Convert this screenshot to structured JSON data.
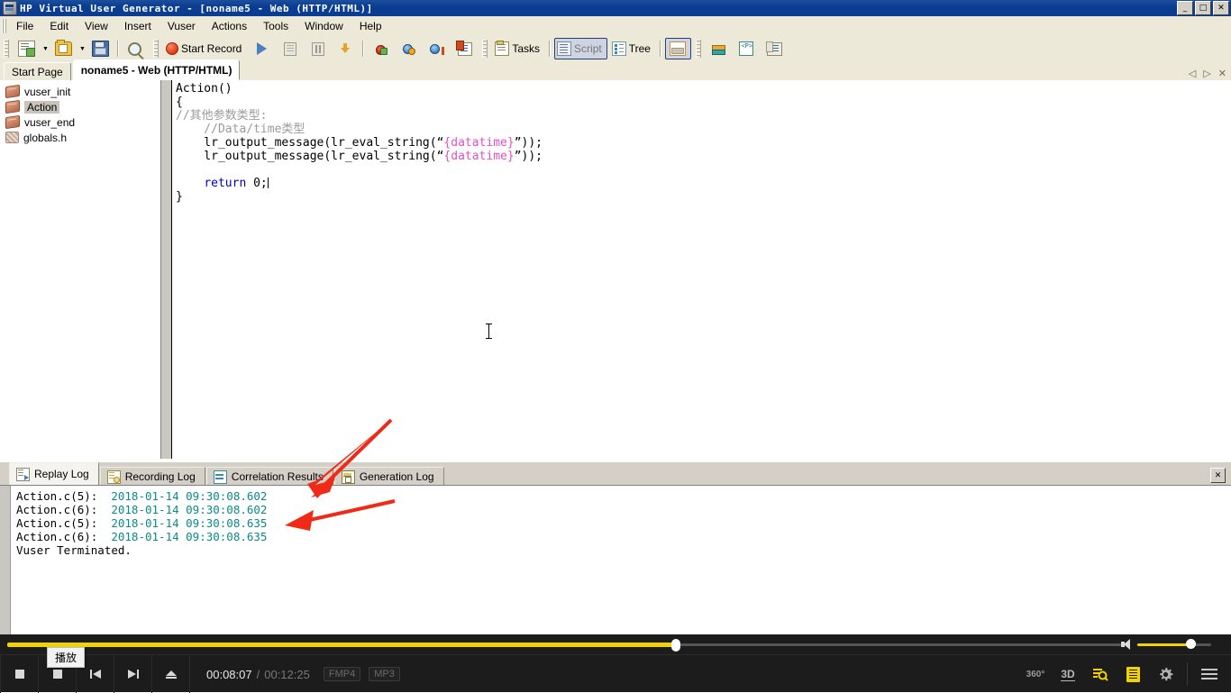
{
  "window": {
    "title": "HP Virtual User Generator - [noname5 - Web (HTTP/HTML)]",
    "app_icon": "vugen-app-icon",
    "minimize": "_",
    "maximize": "□",
    "close": "✕"
  },
  "menubar": {
    "items": [
      {
        "label": "File",
        "mnemonic": "F"
      },
      {
        "label": "Edit",
        "mnemonic": "E"
      },
      {
        "label": "View",
        "mnemonic": "V"
      },
      {
        "label": "Insert",
        "mnemonic": "I"
      },
      {
        "label": "Vuser",
        "mnemonic": "u"
      },
      {
        "label": "Actions",
        "mnemonic": "A"
      },
      {
        "label": "Tools",
        "mnemonic": "T"
      },
      {
        "label": "Window",
        "mnemonic": "W"
      },
      {
        "label": "Help",
        "mnemonic": "H"
      }
    ]
  },
  "toolbar": {
    "new_script_icon": "new-script-icon",
    "open_icon": "open-folder-icon",
    "save_icon": "save-icon",
    "find_icon": "search-icon",
    "start_record_label": "Start Record",
    "record_icon": "record-icon",
    "run_icon": "play-icon",
    "stop_icon": "stop-icon",
    "pause_icon": "pause-icon",
    "download_icon": "download-icon",
    "bug_icon": "bug-icon",
    "clock_icon": "clock-icon",
    "runlogic_icon": "run-logic-icon",
    "props_icon": "properties-icon",
    "tasks_label": "Tasks",
    "tasks_icon": "tasks-icon",
    "script_label": "Script",
    "script_icon": "script-view-icon",
    "tree_label": "Tree",
    "tree_icon": "tree-view-icon",
    "splitview_icon": "split-view-icon",
    "recgen_icon": "recording-options-icon",
    "param_icon": "parameter-list-icon",
    "snapshot_icon": "snapshot-icon",
    "caret": "▼"
  },
  "tabstrip": {
    "tabs": [
      {
        "label": "Start Page",
        "active": false
      },
      {
        "label": "noname5 - Web (HTTP/HTML)",
        "active": true
      }
    ],
    "nav_prev": "◁",
    "nav_next": "▷",
    "nav_close": "✕"
  },
  "tree": {
    "items": [
      {
        "label": "vuser_init",
        "icon": "action-brick-icon",
        "selected": false
      },
      {
        "label": "Action",
        "icon": "action-brick-icon",
        "selected": true
      },
      {
        "label": "vuser_end",
        "icon": "action-brick-icon",
        "selected": false
      },
      {
        "label": "globals.h",
        "icon": "header-file-icon",
        "selected": false
      }
    ]
  },
  "editor": {
    "lines": [
      {
        "segs": [
          {
            "t": "Action()",
            "c": "plain"
          }
        ]
      },
      {
        "segs": [
          {
            "t": "{",
            "c": "plain"
          }
        ]
      },
      {
        "segs": [
          {
            "t": "//其他参数类型:",
            "c": "comment"
          }
        ]
      },
      {
        "segs": [
          {
            "t": "    //Data/time类型",
            "c": "comment"
          }
        ]
      },
      {
        "segs": [
          {
            "t": "    lr_output_message(lr_eval_string(“",
            "c": "plain"
          },
          {
            "t": "{datatime}",
            "c": "param"
          },
          {
            "t": "”));",
            "c": "plain"
          }
        ]
      },
      {
        "segs": [
          {
            "t": "    lr_output_message(lr_eval_string(“",
            "c": "plain"
          },
          {
            "t": "{datatime}",
            "c": "param"
          },
          {
            "t": "”));",
            "c": "plain"
          }
        ]
      },
      {
        "segs": [
          {
            "t": "",
            "c": "plain"
          }
        ]
      },
      {
        "segs": [
          {
            "t": "    ",
            "c": "plain"
          },
          {
            "t": "return",
            "c": "kw"
          },
          {
            "t": " 0;",
            "c": "plain"
          },
          {
            "t": "|",
            "c": "caret"
          }
        ]
      },
      {
        "segs": [
          {
            "t": "}",
            "c": "plain"
          }
        ]
      }
    ]
  },
  "logtabs": {
    "tabs": [
      {
        "label": "Replay Log",
        "icon": "replay-log-icon",
        "active": true
      },
      {
        "label": "Recording Log",
        "icon": "recording-log-icon",
        "active": false
      },
      {
        "label": "Correlation Results",
        "icon": "correlation-results-icon",
        "active": false
      },
      {
        "label": "Generation Log",
        "icon": "generation-log-icon",
        "active": false
      }
    ],
    "close": "✕"
  },
  "log": {
    "lines": [
      {
        "prefix": "Action.c(5):  ",
        "ts": "2018-01-14 09:30:08.602"
      },
      {
        "prefix": "Action.c(6):  ",
        "ts": "2018-01-14 09:30:08.602"
      },
      {
        "prefix": "Action.c(5):  ",
        "ts": "2018-01-14 09:30:08.635"
      },
      {
        "prefix": "Action.c(6):  ",
        "ts": "2018-01-14 09:30:08.635"
      },
      {
        "prefix": "Vuser Terminated.",
        "ts": ""
      }
    ]
  },
  "annotations": {
    "arrow_color": "#ef2b18",
    "arrows": [
      {
        "name": "arrow-to-correlation-tab"
      },
      {
        "name": "arrow-to-log-timestamp"
      }
    ]
  },
  "player": {
    "play_tooltip": "播放",
    "play_icon": "play-icon",
    "prev_icon": "previous-track-icon",
    "next_icon": "next-track-icon",
    "eject_icon": "eject-icon",
    "current_time": "00:08:07",
    "separator": "/",
    "total_time": "00:12:25",
    "format_video": "FMP4",
    "format_audio": "MP3",
    "progress_percent": 60,
    "volume_percent": 72,
    "volume_icon": "speaker-icon",
    "right_controls": [
      {
        "label": "360°",
        "name": "360-view-button"
      },
      {
        "label": "3D",
        "name": "3d-view-button"
      },
      {
        "label": "",
        "name": "zoom-search-icon"
      },
      {
        "label": "",
        "name": "notes-icon"
      },
      {
        "label": "",
        "name": "settings-gear-icon"
      },
      {
        "label": "",
        "name": "menu-hamburger-icon"
      }
    ]
  },
  "colors": {
    "titlebar": "#0a3d91",
    "chrome": "#ece9d8",
    "accent_yellow": "#f2d300",
    "log_timestamp": "#0a8a8a",
    "param_pink": "#e050c8",
    "keyword_blue": "#0000c0"
  }
}
